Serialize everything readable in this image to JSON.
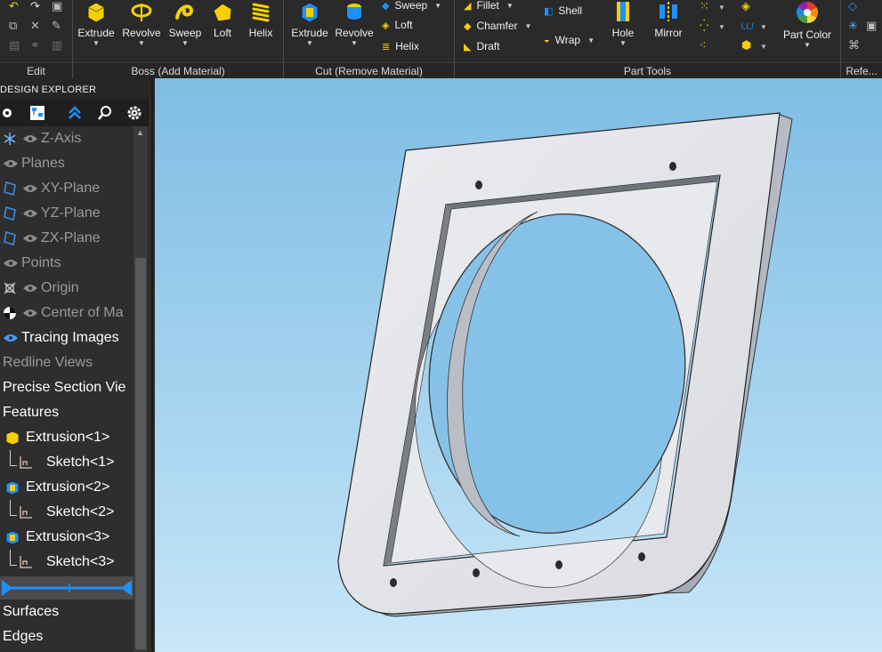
{
  "ribbon": {
    "groups": {
      "edit": "Edit",
      "boss": "Boss (Add Material)",
      "cut": "Cut (Remove Material)",
      "part_tools": "Part Tools",
      "reference": "Refe..."
    },
    "boss_buttons": [
      "Extrude",
      "Revolve",
      "Sweep",
      "Loft",
      "Helix"
    ],
    "cut_buttons": [
      "Extrude",
      "Revolve"
    ],
    "cut_small": [
      "Sweep",
      "Loft",
      "Helix"
    ],
    "tools_small": [
      "Fillet",
      "Chamfer",
      "Draft",
      "Shell",
      "Wrap"
    ],
    "tools_big": [
      "Hole",
      "Mirror"
    ],
    "part_color": "Part Color"
  },
  "explorer": {
    "title": "DESIGN EXPLORER",
    "items": [
      {
        "label": "Z-Axis"
      },
      {
        "label": "Planes"
      },
      {
        "label": "XY-Plane"
      },
      {
        "label": "YZ-Plane"
      },
      {
        "label": "ZX-Plane"
      },
      {
        "label": "Points"
      },
      {
        "label": "Origin"
      },
      {
        "label": "Center of Ma"
      },
      {
        "label": "Tracing Images"
      },
      {
        "label": "Redline Views"
      },
      {
        "label": "Precise Section Vie"
      },
      {
        "label": "Features"
      },
      {
        "label": "Extrusion<1>"
      },
      {
        "label": "Sketch<1>"
      },
      {
        "label": "Extrusion<2>"
      },
      {
        "label": "Sketch<2>"
      },
      {
        "label": "Extrusion<3>"
      },
      {
        "label": "Sketch<3>"
      },
      {
        "label": "Surfaces"
      },
      {
        "label": "Edges"
      }
    ]
  },
  "colors": {
    "accent": "#1e90ff",
    "yellow": "#f5d000",
    "part": "#e4e6ea"
  }
}
